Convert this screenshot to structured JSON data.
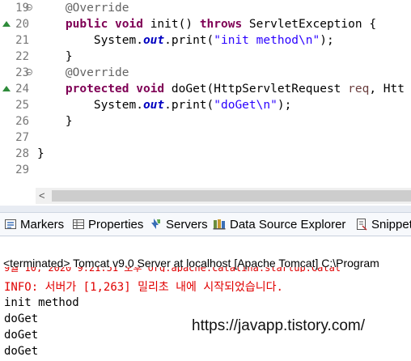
{
  "editor": {
    "lines": [
      {
        "num": "19",
        "fold": true,
        "override": false,
        "tokens": [
          {
            "t": "    ",
            "c": ""
          },
          {
            "t": "@Override",
            "c": "ann"
          }
        ]
      },
      {
        "num": "20",
        "fold": false,
        "override": true,
        "tokens": [
          {
            "t": "    ",
            "c": ""
          },
          {
            "t": "public",
            "c": "kw"
          },
          {
            "t": " ",
            "c": ""
          },
          {
            "t": "void",
            "c": "kw"
          },
          {
            "t": " init() ",
            "c": ""
          },
          {
            "t": "throws",
            "c": "kw"
          },
          {
            "t": " ServletException {",
            "c": ""
          }
        ]
      },
      {
        "num": "21",
        "fold": false,
        "override": false,
        "tokens": [
          {
            "t": "        System.",
            "c": ""
          },
          {
            "t": "out",
            "c": "fld"
          },
          {
            "t": ".print(",
            "c": ""
          },
          {
            "t": "\"init method\\n\"",
            "c": "str"
          },
          {
            "t": ");",
            "c": ""
          }
        ]
      },
      {
        "num": "22",
        "fold": false,
        "override": false,
        "tokens": [
          {
            "t": "    }",
            "c": ""
          }
        ]
      },
      {
        "num": "23",
        "fold": true,
        "override": false,
        "tokens": [
          {
            "t": "    ",
            "c": ""
          },
          {
            "t": "@Override",
            "c": "ann"
          }
        ]
      },
      {
        "num": "24",
        "fold": false,
        "override": true,
        "tokens": [
          {
            "t": "    ",
            "c": ""
          },
          {
            "t": "protected",
            "c": "kw"
          },
          {
            "t": " ",
            "c": ""
          },
          {
            "t": "void",
            "c": "kw"
          },
          {
            "t": " doGet(HttpServletRequest ",
            "c": ""
          },
          {
            "t": "req",
            "c": "prm"
          },
          {
            "t": ", Htt",
            "c": ""
          }
        ]
      },
      {
        "num": "25",
        "fold": false,
        "override": false,
        "tokens": [
          {
            "t": "        System.",
            "c": ""
          },
          {
            "t": "out",
            "c": "fld"
          },
          {
            "t": ".print(",
            "c": ""
          },
          {
            "t": "\"doGet\\n\"",
            "c": "str"
          },
          {
            "t": ");",
            "c": ""
          }
        ]
      },
      {
        "num": "26",
        "fold": false,
        "override": false,
        "tokens": [
          {
            "t": "    }",
            "c": ""
          }
        ]
      },
      {
        "num": "27",
        "fold": false,
        "override": false,
        "tokens": []
      },
      {
        "num": "28",
        "fold": false,
        "override": false,
        "tokens": [
          {
            "t": "}",
            "c": ""
          }
        ]
      },
      {
        "num": "29",
        "fold": false,
        "override": false,
        "tokens": []
      }
    ],
    "scroll_left_glyph": "<"
  },
  "tabs": [
    {
      "label": "Markers",
      "icon": "markers-icon"
    },
    {
      "label": "Properties",
      "icon": "properties-icon"
    },
    {
      "label": "Servers",
      "icon": "servers-icon"
    },
    {
      "label": "Data Source Explorer",
      "icon": "data-source-explorer-icon"
    },
    {
      "label": "Snippet",
      "icon": "snippets-icon"
    }
  ],
  "console": {
    "header": "<terminated> Tomcat v9.0 Server at localhost [Apache Tomcat] C:\\Program",
    "cut_line": "9월 10, 2020 9:21:51 오후 org.apache.catalina.startup.Catal",
    "info_line": "INFO: 서버가 [1,263] 밀리초 내에 시작되었습니다.",
    "output": [
      "init method",
      "doGet",
      "doGet",
      "doGet"
    ]
  },
  "watermark": "https://javapp.tistory.com/",
  "colors": {
    "keyword": "#7f0055",
    "annotation": "#646464",
    "string": "#2a00ff",
    "field": "#0000c0",
    "error": "#e00000"
  }
}
